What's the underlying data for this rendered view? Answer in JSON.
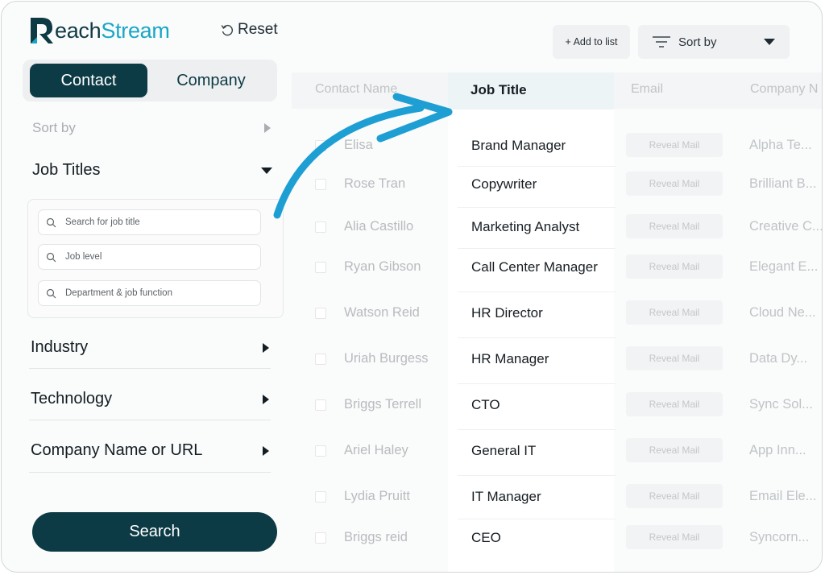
{
  "brand": {
    "name_prefix": "R",
    "name_main": "each",
    "name_accent": "Stream",
    "brand_color": "#0e3a44",
    "accent_color": "#1aa6c7"
  },
  "header": {
    "reset_label": "Reset",
    "reset_icon": "refresh-icon"
  },
  "toggle": {
    "contact_label": "Contact",
    "company_label": "Company",
    "active": "Contact"
  },
  "sidebar": {
    "sort_by_label": "Sort by",
    "job_titles": {
      "label": "Job Titles",
      "expanded": true,
      "search_placeholder": "Search for job title",
      "level_placeholder": "Job level",
      "department_placeholder": "Department & job function"
    },
    "sections": [
      {
        "label": "Industry"
      },
      {
        "label": "Technology"
      },
      {
        "label": "Company Name or URL"
      }
    ],
    "search_button_label": "Search"
  },
  "toolbar": {
    "add_to_list_label": "+ Add to list",
    "sort_by_label": "Sort by"
  },
  "table": {
    "columns": [
      "Contact Name",
      "Job Title",
      "Email",
      "Company N"
    ],
    "rows": [
      {
        "name": "Elisa",
        "job": "Brand Manager",
        "email_action": "Reveal Mail",
        "company": "Alpha Te..."
      },
      {
        "name": "Rose Tran",
        "job": "Copywriter",
        "email_action": "Reveal Mail",
        "company": "Brilliant B..."
      },
      {
        "name": "Alia Castillo",
        "job": "Marketing Analyst",
        "email_action": "Reveal Mail",
        "company": "Creative C..."
      },
      {
        "name": "Ryan Gibson",
        "job": "Call Center Manager",
        "email_action": "Reveal Mail",
        "company": "Elegant E..."
      },
      {
        "name": "Watson Reid",
        "job": "HR Director",
        "email_action": "Reveal Mail",
        "company": "Cloud Ne..."
      },
      {
        "name": "Uriah Burgess",
        "job": "HR Manager",
        "email_action": "Reveal Mail",
        "company": "Data Dy..."
      },
      {
        "name": "Briggs Terrell",
        "job": "CTO",
        "email_action": "Reveal Mail",
        "company": "Sync Sol..."
      },
      {
        "name": "Ariel Haley",
        "job": "General IT",
        "email_action": "Reveal Mail",
        "company": "App Inn..."
      },
      {
        "name": "Lydia Pruitt",
        "job": "IT Manager",
        "email_action": "Reveal Mail",
        "company": "Email Ele..."
      },
      {
        "name": "Briggs reid",
        "job": "CEO",
        "email_action": "Reveal Mail",
        "company": "Syncorn..."
      }
    ]
  }
}
